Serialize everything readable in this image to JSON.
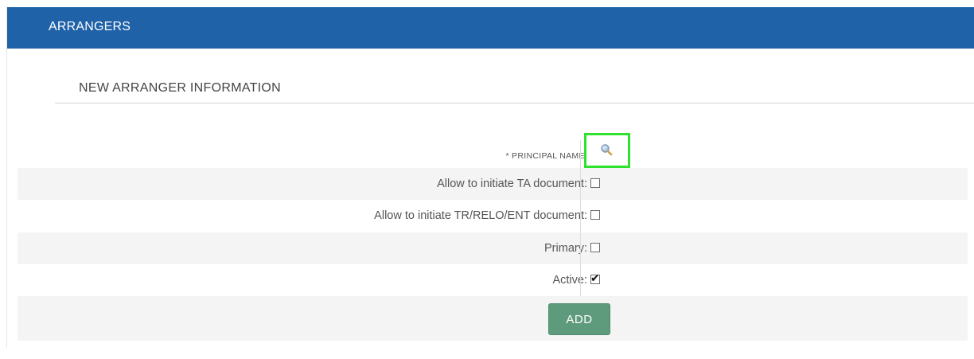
{
  "panel": {
    "title": "ARRANGERS"
  },
  "section": {
    "title": "NEW ARRANGER INFORMATION"
  },
  "form": {
    "principal_name_label": "* PRINCIPAL NAME:",
    "lookup_icon": "search-icon",
    "fields": [
      {
        "label": "Allow to initiate TA document:",
        "checked": false
      },
      {
        "label": "Allow to initiate TR/RELO/ENT document:",
        "checked": false
      },
      {
        "label": "Primary:",
        "checked": false
      },
      {
        "label": "Active:",
        "checked": true
      }
    ],
    "checkmark": "✔",
    "add_label": "ADD"
  },
  "colors": {
    "header": "#1f62a8",
    "button": "#5e9b7c",
    "highlight": "#2ee22e"
  }
}
